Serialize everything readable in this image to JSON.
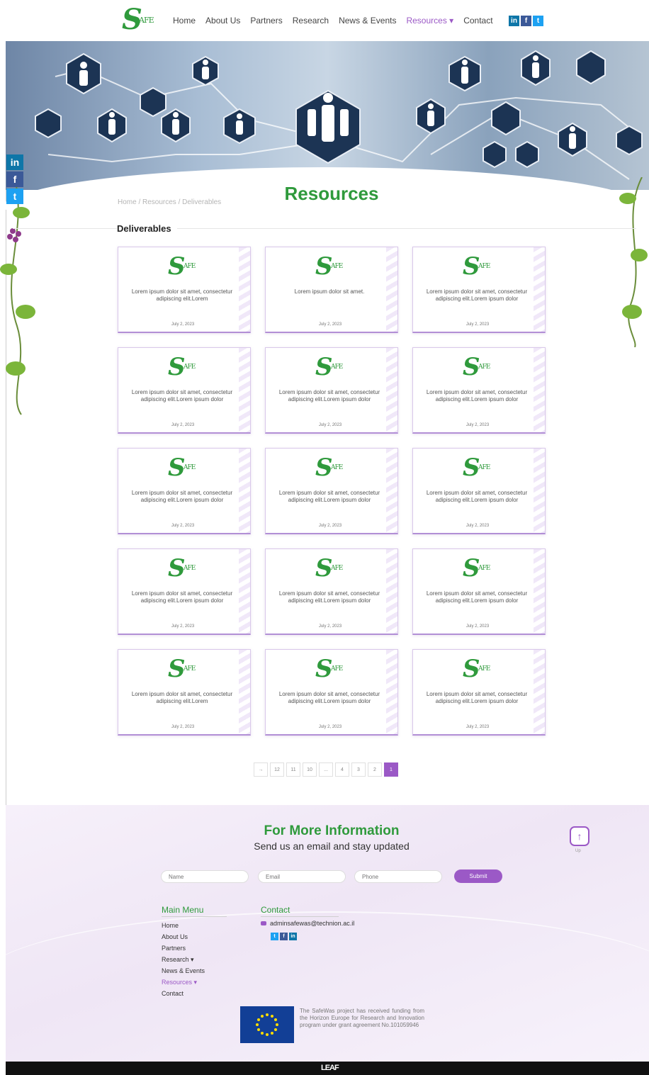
{
  "header": {
    "logo_letter": "S",
    "logo_text": "AFE",
    "nav": [
      {
        "label": "Home"
      },
      {
        "label": "About Us"
      },
      {
        "label": "Partners"
      },
      {
        "label": "Research"
      },
      {
        "label": "News & Events"
      },
      {
        "label": "Resources ▾",
        "active": true
      },
      {
        "label": "Contact"
      }
    ],
    "social": {
      "linkedin": "in",
      "facebook": "f",
      "twitter": "t"
    }
  },
  "side_social": {
    "linkedin": "in",
    "facebook": "f",
    "twitter": "t"
  },
  "page": {
    "breadcrumb": "Home / Resources / Deliverables",
    "title": "Resources",
    "section_title": "Deliverables"
  },
  "cards": [
    {
      "text": "Lorem ipsum dolor sit amet, consectetur adipiscing elit.Lorem",
      "date": "July 2, 2023"
    },
    {
      "text": "Lorem ipsum dolor sit amet.",
      "date": "July 2, 2023"
    },
    {
      "text": "Lorem ipsum dolor sit amet, consectetur adipiscing elit.Lorem ipsum dolor",
      "date": "July 2, 2023"
    },
    {
      "text": "Lorem ipsum dolor sit amet, consectetur adipiscing elit.Lorem ipsum dolor",
      "date": "July 2, 2023"
    },
    {
      "text": "Lorem ipsum dolor sit amet, consectetur adipiscing elit.Lorem ipsum dolor",
      "date": "July 2, 2023"
    },
    {
      "text": "Lorem ipsum dolor sit amet, consectetur adipiscing elit.Lorem ipsum dolor",
      "date": "July 2, 2023"
    },
    {
      "text": "Lorem ipsum dolor sit amet, consectetur adipiscing elit.Lorem ipsum dolor",
      "date": "July 2, 2023"
    },
    {
      "text": "Lorem ipsum dolor sit amet, consectetur adipiscing elit.Lorem ipsum dolor",
      "date": "July 2, 2023"
    },
    {
      "text": "Lorem ipsum dolor sit amet, consectetur adipiscing elit.Lorem ipsum dolor",
      "date": "July 2, 2023"
    },
    {
      "text": "Lorem ipsum dolor sit amet, consectetur adipiscing elit.Lorem ipsum dolor",
      "date": "July 2, 2023"
    },
    {
      "text": "Lorem ipsum dolor sit amet, consectetur adipiscing elit.Lorem ipsum dolor",
      "date": "July 2, 2023"
    },
    {
      "text": "Lorem ipsum dolor sit amet, consectetur adipiscing elit.Lorem ipsum dolor",
      "date": "July 2, 2023"
    },
    {
      "text": "Lorem ipsum dolor sit amet, consectetur adipiscing elit.Lorem",
      "date": "July 2, 2023"
    },
    {
      "text": "Lorem ipsum dolor sit amet, consectetur adipiscing elit.Lorem ipsum dolor",
      "date": "July 2, 2023"
    },
    {
      "text": "Lorem ipsum dolor sit amet, consectetur adipiscing elit.Lorem ipsum dolor",
      "date": "July 2, 2023"
    }
  ],
  "pagination": {
    "items": [
      "→",
      "12",
      "11",
      "10",
      "...",
      "4",
      "3",
      "2",
      "1"
    ],
    "active": "1"
  },
  "footer": {
    "title": "For More Information",
    "subtitle": "Send us an email and stay updated",
    "top_label": "Up",
    "form": {
      "name_placeholder": "Name",
      "email_placeholder": "Email",
      "phone_placeholder": "Phone",
      "submit_label": "Submit"
    },
    "main_menu_title": "Main Menu",
    "main_menu": [
      {
        "label": "Home"
      },
      {
        "label": "About Us"
      },
      {
        "label": "Partners"
      },
      {
        "label": "Research ▾"
      },
      {
        "label": "News & Events"
      },
      {
        "label": "Resources ▾",
        "active": true
      },
      {
        "label": "Contact"
      }
    ],
    "contact_title": "Contact",
    "email": "adminsafewas@technion.ac.il",
    "social": {
      "twitter": "t",
      "facebook": "f",
      "linkedin": "in"
    },
    "eu_text": "The SafeWas project has received funding from the Horizon Europe for Research and Innovation program under grant agreement No.101059946",
    "bottom_logo": "LEAF"
  },
  "colors": {
    "brand_green": "#2f9a3c",
    "accent_purple": "#9b59c6"
  }
}
